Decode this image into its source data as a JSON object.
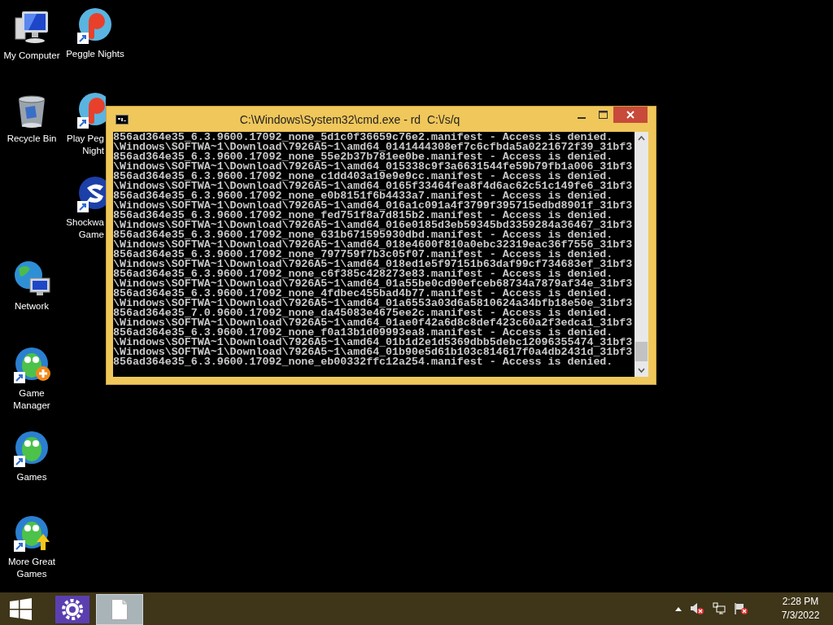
{
  "desktop": {
    "icons": [
      {
        "kind": "computer",
        "label": [
          "My Computer"
        ]
      },
      {
        "kind": "recycle-bin",
        "label": [
          "Recycle Bin"
        ]
      },
      {
        "kind": "network",
        "label": [
          "Network"
        ]
      },
      {
        "kind": "game-manager",
        "label": [
          "Game",
          "Manager"
        ]
      },
      {
        "kind": "games",
        "label": [
          "Games"
        ]
      },
      {
        "kind": "more-games",
        "label": [
          "More Great",
          "Games"
        ]
      },
      {
        "kind": "peggle",
        "label": [
          "Peggle Nights"
        ]
      },
      {
        "kind": "peggle",
        "label": [
          "Play Peg",
          "Night"
        ]
      },
      {
        "kind": "shockwave",
        "label": [
          "Shockwa",
          "Game"
        ]
      }
    ]
  },
  "window": {
    "title": "C:\\Windows\\System32\\cmd.exe - rd  C:\\/s/q",
    "lines": [
      "856ad364e35_6.3.9600.17092_none_5d1c0f36659c76e2.manifest - Access is denied.",
      "\\Windows\\SOFTWA~1\\Download\\7926A5~1\\amd64_0141444308ef7c6cfbda5a0221672f39_31bf3",
      "856ad364e35_6.3.9600.17092_none_55e2b37b781ee0be.manifest - Access is denied.",
      "\\Windows\\SOFTWA~1\\Download\\7926A5~1\\amd64_015338c9f3a6631544fe59b79fb1a006_31bf3",
      "856ad364e35_6.3.9600.17092_none_c1dd403a19e9e9cc.manifest - Access is denied.",
      "\\Windows\\SOFTWA~1\\Download\\7926A5~1\\amd64_0165f33464fea8f4d6ac62c51c149fe6_31bf3",
      "856ad364e35_6.3.9600.17092_none_e0b8151f6b4433a7.manifest - Access is denied.",
      "\\Windows\\SOFTWA~1\\Download\\7926A5~1\\amd64_016a1c091a4f3799f395715edbd8901f_31bf3",
      "856ad364e35_6.3.9600.17092_none_fed751f8a7d815b2.manifest - Access is denied.",
      "\\Windows\\SOFTWA~1\\Download\\7926A5~1\\amd64_016e0185d3eb59345bd3359284a36467_31bf3",
      "856ad364e35_6.3.9600.17092_none_631b671595930dbd.manifest - Access is denied.",
      "\\Windows\\SOFTWA~1\\Download\\7926A5~1\\amd64_018e4600f810a0ebc32319eac36f7556_31bf3",
      "856ad364e35_6.3.9600.17092_none_797759f7b3c05f07.manifest - Access is denied.",
      "\\Windows\\SOFTWA~1\\Download\\7926A5~1\\amd64_018ed1e5f97151b63daf99cf734683ef_31bf3",
      "856ad364e35_6.3.9600.17092_none_c6f385c428273e83.manifest - Access is denied.",
      "\\Windows\\SOFTWA~1\\Download\\7926A5~1\\amd64_01a55be0cd90efceb68734a7879af34e_31bf3",
      "856ad364e35_6.3.9600.17092_none_4fdbec455bad4b77.manifest - Access is denied.",
      "\\Windows\\SOFTWA~1\\Download\\7926A5~1\\amd64_01a6553a03d6a5810624a34bfb18e50e_31bf3",
      "856ad364e35_7.0.9600.17092_none_da45083e4675ee2c.manifest - Access is denied.",
      "\\Windows\\SOFTWA~1\\Download\\7926A5~1\\amd64_01ae0f42a6d8c8def423c60a2f3edca1_31bf3",
      "856ad364e35_6.3.9600.17092_none_f0a13b1d09993ea8.manifest - Access is denied.",
      "\\Windows\\SOFTWA~1\\Download\\7926A5~1\\amd64_01b1d2e1d5369dbb5debc12096355474_31bf3",
      "\\Windows\\SOFTWA~1\\Download\\7926A5~1\\amd64_01b90e5d61b103c814617f0a4db2431d_31bf3",
      "856ad364e35_6.3.9600.17092_none_eb00332ffc12a254.manifest - Access is denied."
    ]
  },
  "taskbar": {
    "apps": [
      {
        "kind": "settings",
        "selected": false
      },
      {
        "kind": "document",
        "selected": true
      }
    ],
    "tray": {
      "time": "2:28 PM",
      "date": "7/3/2022"
    }
  }
}
